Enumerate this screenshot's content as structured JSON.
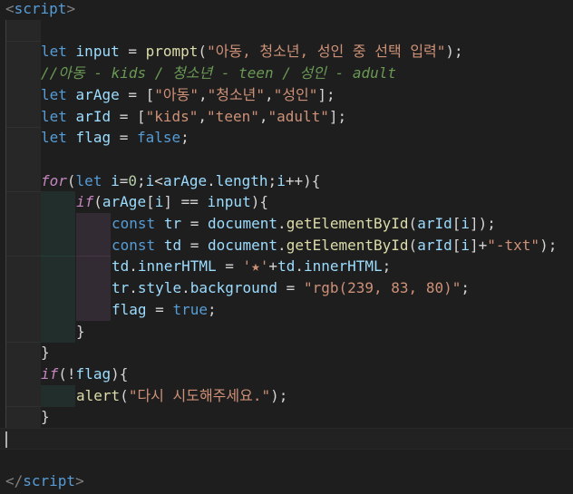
{
  "colors": {
    "background": "#1e1e1e",
    "tag": "#808080",
    "tagName": "#569cd6",
    "keyword": "#569cd6",
    "control": "#c586c0",
    "variable": "#9cdcfe",
    "function": "#dcdcaa",
    "string": "#ce9178",
    "number": "#b5cea8",
    "comment": "#6a9955",
    "text": "#d4d4d4"
  },
  "lines": [
    {
      "indent": 0,
      "guides": [],
      "tokens": [
        {
          "t": "<",
          "c": "tag"
        },
        {
          "t": "script",
          "c": "tagName"
        },
        {
          "t": ">",
          "c": "tag"
        }
      ]
    },
    {
      "indent": 0,
      "guides": [
        0
      ],
      "tokens": []
    },
    {
      "indent": 1,
      "guides": [
        0
      ],
      "tokens": [
        {
          "t": "let",
          "c": "keyword"
        },
        {
          "t": " ",
          "c": "text"
        },
        {
          "t": "input",
          "c": "variable"
        },
        {
          "t": " = ",
          "c": "text"
        },
        {
          "t": "prompt",
          "c": "function"
        },
        {
          "t": "(",
          "c": "text"
        },
        {
          "t": "\"아동, 청소년, 성인 중 선택 입력\"",
          "c": "string"
        },
        {
          "t": ");",
          "c": "text"
        }
      ]
    },
    {
      "indent": 1,
      "guides": [
        0
      ],
      "tokens": [
        {
          "t": "//아동 - kids / 청소년 - teen / 성인 - adult",
          "c": "comment",
          "i": true
        }
      ]
    },
    {
      "indent": 1,
      "guides": [
        0
      ],
      "tokens": [
        {
          "t": "let",
          "c": "keyword"
        },
        {
          "t": " ",
          "c": "text"
        },
        {
          "t": "arAge",
          "c": "variable"
        },
        {
          "t": " = [",
          "c": "text"
        },
        {
          "t": "\"아동\"",
          "c": "string"
        },
        {
          "t": ",",
          "c": "text"
        },
        {
          "t": "\"청소년\"",
          "c": "string"
        },
        {
          "t": ",",
          "c": "text"
        },
        {
          "t": "\"성인\"",
          "c": "string"
        },
        {
          "t": "];",
          "c": "text"
        }
      ]
    },
    {
      "indent": 1,
      "guides": [
        0
      ],
      "tokens": [
        {
          "t": "let",
          "c": "keyword"
        },
        {
          "t": " ",
          "c": "text"
        },
        {
          "t": "arId",
          "c": "variable"
        },
        {
          "t": " = [",
          "c": "text"
        },
        {
          "t": "\"kids\"",
          "c": "string"
        },
        {
          "t": ",",
          "c": "text"
        },
        {
          "t": "\"teen\"",
          "c": "string"
        },
        {
          "t": ",",
          "c": "text"
        },
        {
          "t": "\"adult\"",
          "c": "string"
        },
        {
          "t": "];",
          "c": "text"
        }
      ]
    },
    {
      "indent": 1,
      "guides": [
        0
      ],
      "tokens": [
        {
          "t": "let",
          "c": "keyword"
        },
        {
          "t": " ",
          "c": "text"
        },
        {
          "t": "flag",
          "c": "variable"
        },
        {
          "t": " = ",
          "c": "text"
        },
        {
          "t": "false",
          "c": "keyword"
        },
        {
          "t": ";",
          "c": "text"
        }
      ]
    },
    {
      "indent": 0,
      "guides": [
        0
      ],
      "tokens": []
    },
    {
      "indent": 1,
      "guides": [
        0
      ],
      "tokens": [
        {
          "t": "for",
          "c": "control",
          "i": true
        },
        {
          "t": "(",
          "c": "text"
        },
        {
          "t": "let",
          "c": "keyword"
        },
        {
          "t": " ",
          "c": "text"
        },
        {
          "t": "i",
          "c": "variable"
        },
        {
          "t": "=",
          "c": "text"
        },
        {
          "t": "0",
          "c": "number"
        },
        {
          "t": ";",
          "c": "text"
        },
        {
          "t": "i",
          "c": "variable"
        },
        {
          "t": "<",
          "c": "text"
        },
        {
          "t": "arAge",
          "c": "variable"
        },
        {
          "t": ".",
          "c": "text"
        },
        {
          "t": "length",
          "c": "variable"
        },
        {
          "t": ";",
          "c": "text"
        },
        {
          "t": "i",
          "c": "variable"
        },
        {
          "t": "++){",
          "c": "text"
        }
      ]
    },
    {
      "indent": 2,
      "guides": [
        0,
        1
      ],
      "tokens": [
        {
          "t": "if",
          "c": "control",
          "i": true
        },
        {
          "t": "(",
          "c": "text"
        },
        {
          "t": "arAge",
          "c": "variable"
        },
        {
          "t": "[",
          "c": "text"
        },
        {
          "t": "i",
          "c": "variable"
        },
        {
          "t": "] == ",
          "c": "text"
        },
        {
          "t": "input",
          "c": "variable"
        },
        {
          "t": "){",
          "c": "text"
        }
      ]
    },
    {
      "indent": 3,
      "guides": [
        0,
        1,
        2
      ],
      "tokens": [
        {
          "t": "const",
          "c": "keyword"
        },
        {
          "t": " ",
          "c": "text"
        },
        {
          "t": "tr",
          "c": "variable"
        },
        {
          "t": " = ",
          "c": "text"
        },
        {
          "t": "document",
          "c": "variable"
        },
        {
          "t": ".",
          "c": "text"
        },
        {
          "t": "getElementById",
          "c": "function"
        },
        {
          "t": "(",
          "c": "text"
        },
        {
          "t": "arId",
          "c": "variable"
        },
        {
          "t": "[",
          "c": "text"
        },
        {
          "t": "i",
          "c": "variable"
        },
        {
          "t": "]);",
          "c": "text"
        }
      ]
    },
    {
      "indent": 3,
      "guides": [
        0,
        1,
        2
      ],
      "tokens": [
        {
          "t": "const",
          "c": "keyword"
        },
        {
          "t": " ",
          "c": "text"
        },
        {
          "t": "td",
          "c": "variable"
        },
        {
          "t": " = ",
          "c": "text"
        },
        {
          "t": "document",
          "c": "variable"
        },
        {
          "t": ".",
          "c": "text"
        },
        {
          "t": "getElementById",
          "c": "function"
        },
        {
          "t": "(",
          "c": "text"
        },
        {
          "t": "arId",
          "c": "variable"
        },
        {
          "t": "[",
          "c": "text"
        },
        {
          "t": "i",
          "c": "variable"
        },
        {
          "t": "]+",
          "c": "text"
        },
        {
          "t": "\"-txt\"",
          "c": "string"
        },
        {
          "t": ");",
          "c": "text"
        }
      ]
    },
    {
      "indent": 3,
      "guides": [
        0,
        1,
        2
      ],
      "tokens": [
        {
          "t": "td",
          "c": "variable"
        },
        {
          "t": ".",
          "c": "text"
        },
        {
          "t": "innerHTML",
          "c": "variable"
        },
        {
          "t": " = ",
          "c": "text"
        },
        {
          "t": "'★'",
          "c": "string"
        },
        {
          "t": "+",
          "c": "text"
        },
        {
          "t": "td",
          "c": "variable"
        },
        {
          "t": ".",
          "c": "text"
        },
        {
          "t": "innerHTML",
          "c": "variable"
        },
        {
          "t": ";",
          "c": "text"
        }
      ]
    },
    {
      "indent": 3,
      "guides": [
        0,
        1,
        2
      ],
      "tokens": [
        {
          "t": "tr",
          "c": "variable"
        },
        {
          "t": ".",
          "c": "text"
        },
        {
          "t": "style",
          "c": "variable"
        },
        {
          "t": ".",
          "c": "text"
        },
        {
          "t": "background",
          "c": "variable"
        },
        {
          "t": " = ",
          "c": "text"
        },
        {
          "t": "\"rgb(239, 83, 80)\"",
          "c": "string"
        },
        {
          "t": ";",
          "c": "text"
        }
      ]
    },
    {
      "indent": 3,
      "guides": [
        0,
        1,
        2
      ],
      "tokens": [
        {
          "t": "flag",
          "c": "variable"
        },
        {
          "t": " = ",
          "c": "text"
        },
        {
          "t": "true",
          "c": "keyword"
        },
        {
          "t": ";",
          "c": "text"
        }
      ]
    },
    {
      "indent": 2,
      "guides": [
        0,
        1
      ],
      "tokens": [
        {
          "t": "}",
          "c": "text"
        }
      ]
    },
    {
      "indent": 1,
      "guides": [
        0
      ],
      "tokens": [
        {
          "t": "}",
          "c": "text"
        }
      ]
    },
    {
      "indent": 1,
      "guides": [
        0
      ],
      "tokens": [
        {
          "t": "if",
          "c": "control",
          "i": true
        },
        {
          "t": "(",
          "c": "text"
        },
        {
          "t": "!",
          "c": "text"
        },
        {
          "t": "flag",
          "c": "variable"
        },
        {
          "t": "){",
          "c": "text"
        }
      ]
    },
    {
      "indent": 2,
      "guides": [
        0,
        1
      ],
      "tokens": [
        {
          "t": "alert",
          "c": "function"
        },
        {
          "t": "(",
          "c": "text"
        },
        {
          "t": "\"다시 시도해주세요.\"",
          "c": "string"
        },
        {
          "t": ");",
          "c": "text"
        }
      ]
    },
    {
      "indent": 1,
      "guides": [
        0
      ],
      "tokens": [
        {
          "t": "}",
          "c": "text"
        }
      ]
    },
    {
      "indent": 0,
      "guides": [],
      "tokens": [],
      "cursor": true
    },
    {
      "indent": 0,
      "guides": [],
      "tokens": []
    },
    {
      "indent": 0,
      "guides": [],
      "tokens": [
        {
          "t": "</",
          "c": "tag"
        },
        {
          "t": "script",
          "c": "tagName"
        },
        {
          "t": ">",
          "c": "tag"
        }
      ]
    }
  ]
}
